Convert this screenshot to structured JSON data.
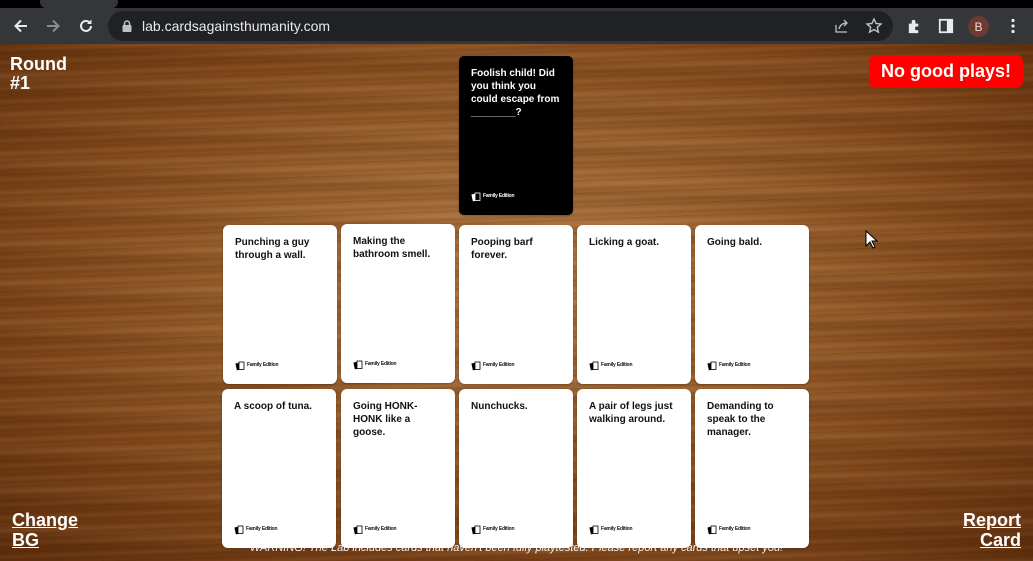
{
  "browser": {
    "url": "lab.cardsagainsthumanity.com",
    "profile_initial": "B",
    "icons": [
      "back-arrow-icon",
      "forward-arrow-icon",
      "reload-icon",
      "lock-icon",
      "share-icon",
      "star-icon",
      "extensions-puzzle-icon",
      "side-panel-icon",
      "kebab-menu-icon"
    ]
  },
  "game": {
    "round_label": "Round",
    "round_number": "#1",
    "no_good_plays_label": "No good plays!",
    "change_bg_line1": "Change",
    "change_bg_line2": "BG",
    "report_line1": "Report",
    "report_line2": "Card",
    "warning": "WARNING! The Lab includes cards that haven't been fully playtested. Please report any cards that upset you!",
    "black_card": {
      "text": "Foolish child! Did you think you could escape from ________?",
      "edition": "Family Edition"
    },
    "white_cards": [
      {
        "text": "Punching a guy through a wall.",
        "edition": "Family Edition"
      },
      {
        "text": "Making the bathroom smell.",
        "edition": "Family Edition"
      },
      {
        "text": "Pooping barf forever.",
        "edition": "Family Edition"
      },
      {
        "text": "Licking a goat.",
        "edition": "Family Edition"
      },
      {
        "text": "Going bald.",
        "edition": "Family Edition"
      },
      {
        "text": "A scoop of tuna.",
        "edition": "Family Edition"
      },
      {
        "text": "Going HONK-HONK like a goose.",
        "edition": "Family Edition"
      },
      {
        "text": "Nunchucks.",
        "edition": "Family Edition"
      },
      {
        "text": "A pair of legs just walking around.",
        "edition": "Family Edition"
      },
      {
        "text": "Demanding to speak to the manager.",
        "edition": "Family Edition"
      }
    ]
  },
  "colors": {
    "no_good_button": "#ff0000",
    "black_card": "#000000",
    "white_card": "#ffffff",
    "chrome_toolbar": "#35363a",
    "omnibox": "#202124"
  }
}
